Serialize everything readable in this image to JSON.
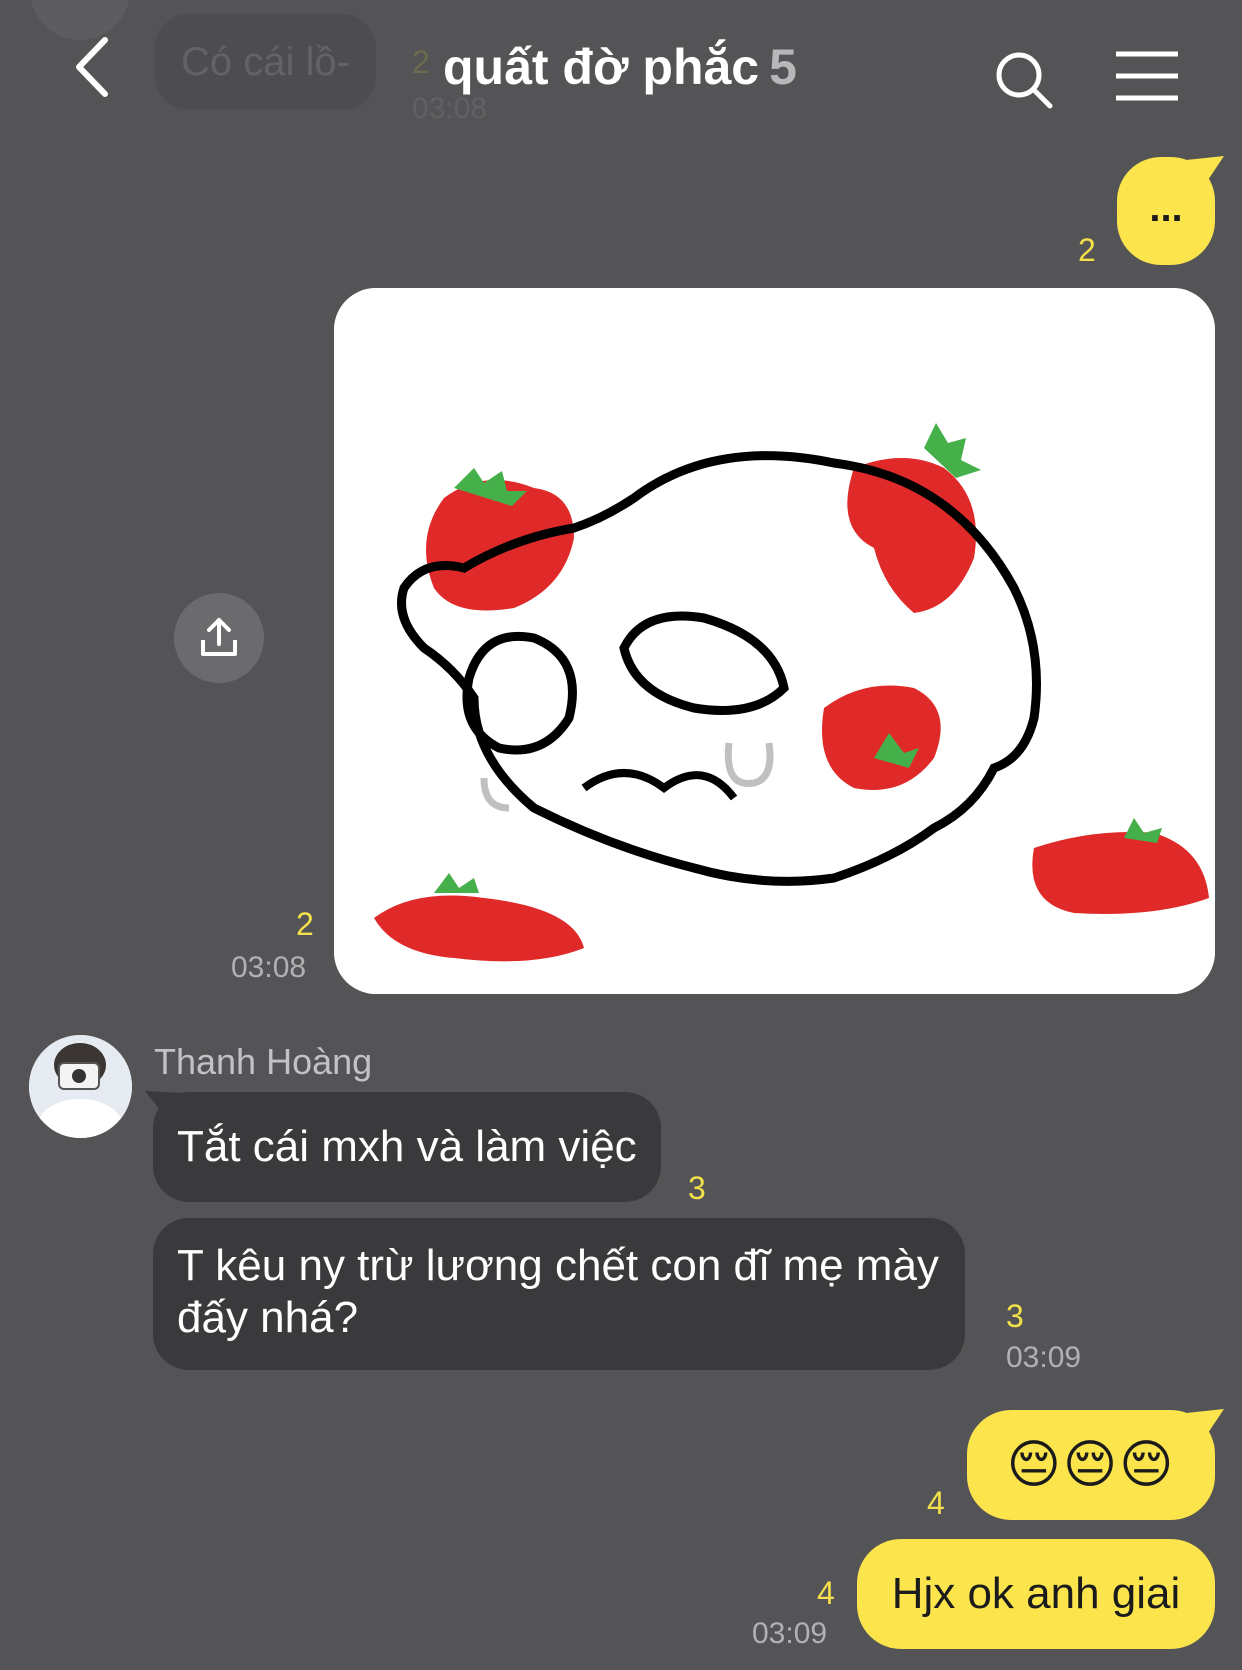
{
  "header": {
    "title": "quất đờ phắc",
    "member_count": "5",
    "behind_preview": {
      "text": "Có cái lồ-",
      "read_count": "2",
      "time": "03:08"
    }
  },
  "icons": {
    "back": "back-chevron-icon",
    "search": "search-icon",
    "menu": "hamburger-menu-icon",
    "share": "share-upload-icon"
  },
  "colors": {
    "background": "#545355",
    "my_bubble": "#fbe44c",
    "their_bubble": "#3a393c",
    "unread_count": "#f3e04a"
  },
  "messages": [
    {
      "from": "me",
      "type": "text",
      "text": "...",
      "read_count": "2"
    },
    {
      "from": "me",
      "type": "image",
      "image_desc": "sticker-skull-strawberries",
      "read_count": "2",
      "time": "03:08"
    },
    {
      "sender": "Thanh Hoàng",
      "from": "them",
      "type": "text",
      "text": "Tắt cái mxh và làm việc",
      "read_count": "3"
    },
    {
      "from": "them",
      "type": "text",
      "text": "T kêu ny trừ lương chết con đĩ mẹ mày đấy nhá?",
      "read_count": "3",
      "time": "03:09"
    },
    {
      "from": "me",
      "type": "text",
      "text": "😔😔😔",
      "read_count": "4"
    },
    {
      "from": "me",
      "type": "text",
      "text": "Hjx ok anh giai",
      "read_count": "4",
      "time": "03:09"
    }
  ]
}
